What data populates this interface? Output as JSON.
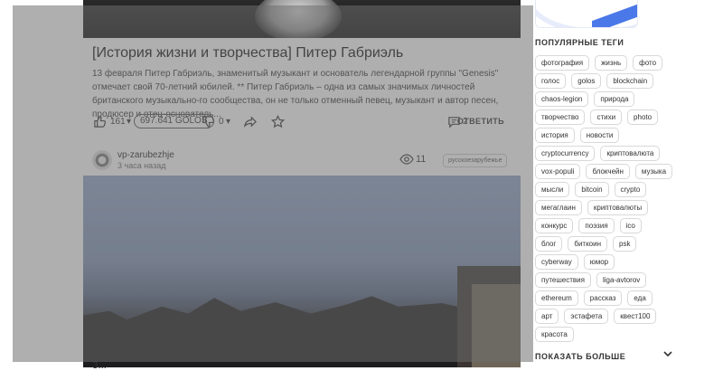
{
  "post1": {
    "title": "[История жизни и творчества] Питер Габриэль",
    "excerpt": "13 февраля Питер Габриэль, знаменитый музыкант и основатель легендарной группы \"Genesis\" отмечает свой 70-летний юбилей. ** Питер Габриэль – одна из самых значимых личностей британского музыкально-го сообщества, он не только отменный певец, музыкант и автор песен, продюсер и отец-основатель...",
    "likes": "161",
    "payout": "697.641 GOLOS",
    "dislikes": "0",
    "comments": "2",
    "answer_label": "ОТВЕТИТЬ"
  },
  "post2": {
    "author": "vp-zarubezhje",
    "time_ago": "3 часа назад",
    "views": "11",
    "category": "русскоезарубежье"
  },
  "below_text": "З...",
  "sidebar": {
    "popular_tags_title": "ПОПУЛЯРНЫЕ ТЕГИ",
    "tag_rows": [
      [
        "фотография",
        "жизнь",
        "фото"
      ],
      [
        "голос",
        "golos",
        "blockchain"
      ],
      [
        "chaos-legion",
        "природа"
      ],
      [
        "творчество",
        "стихи",
        "photo"
      ],
      [
        "история",
        "новости"
      ],
      [
        "cryptocurrency",
        "криптовалюта"
      ],
      [
        "vox-populi",
        "блокчейн",
        "музыка"
      ],
      [
        "мысли",
        "bitcoin",
        "crypto"
      ],
      [
        "мегаглаин",
        "криптовалюты"
      ],
      [
        "конкурс",
        "поэзия",
        "ico"
      ],
      [
        "блог",
        "биткоин",
        "psk"
      ],
      [
        "cyberway",
        "юмор"
      ],
      [
        "путешествия",
        "liga-avtorov"
      ],
      [
        "ethereum",
        "рассказ",
        "еда"
      ],
      [
        "арт",
        "эстафета",
        "квест100"
      ],
      [
        "красота"
      ]
    ],
    "show_more_label": "ПОКАЗАТЬ БОЛЬШЕ"
  },
  "colors": {
    "overlay": "#6e6e6e",
    "accent": "#4a78e8"
  },
  "icons": [
    "like-icon",
    "dislike-icon",
    "share-icon",
    "star-icon",
    "comment-icon",
    "eye-icon",
    "chevron-down-icon"
  ]
}
